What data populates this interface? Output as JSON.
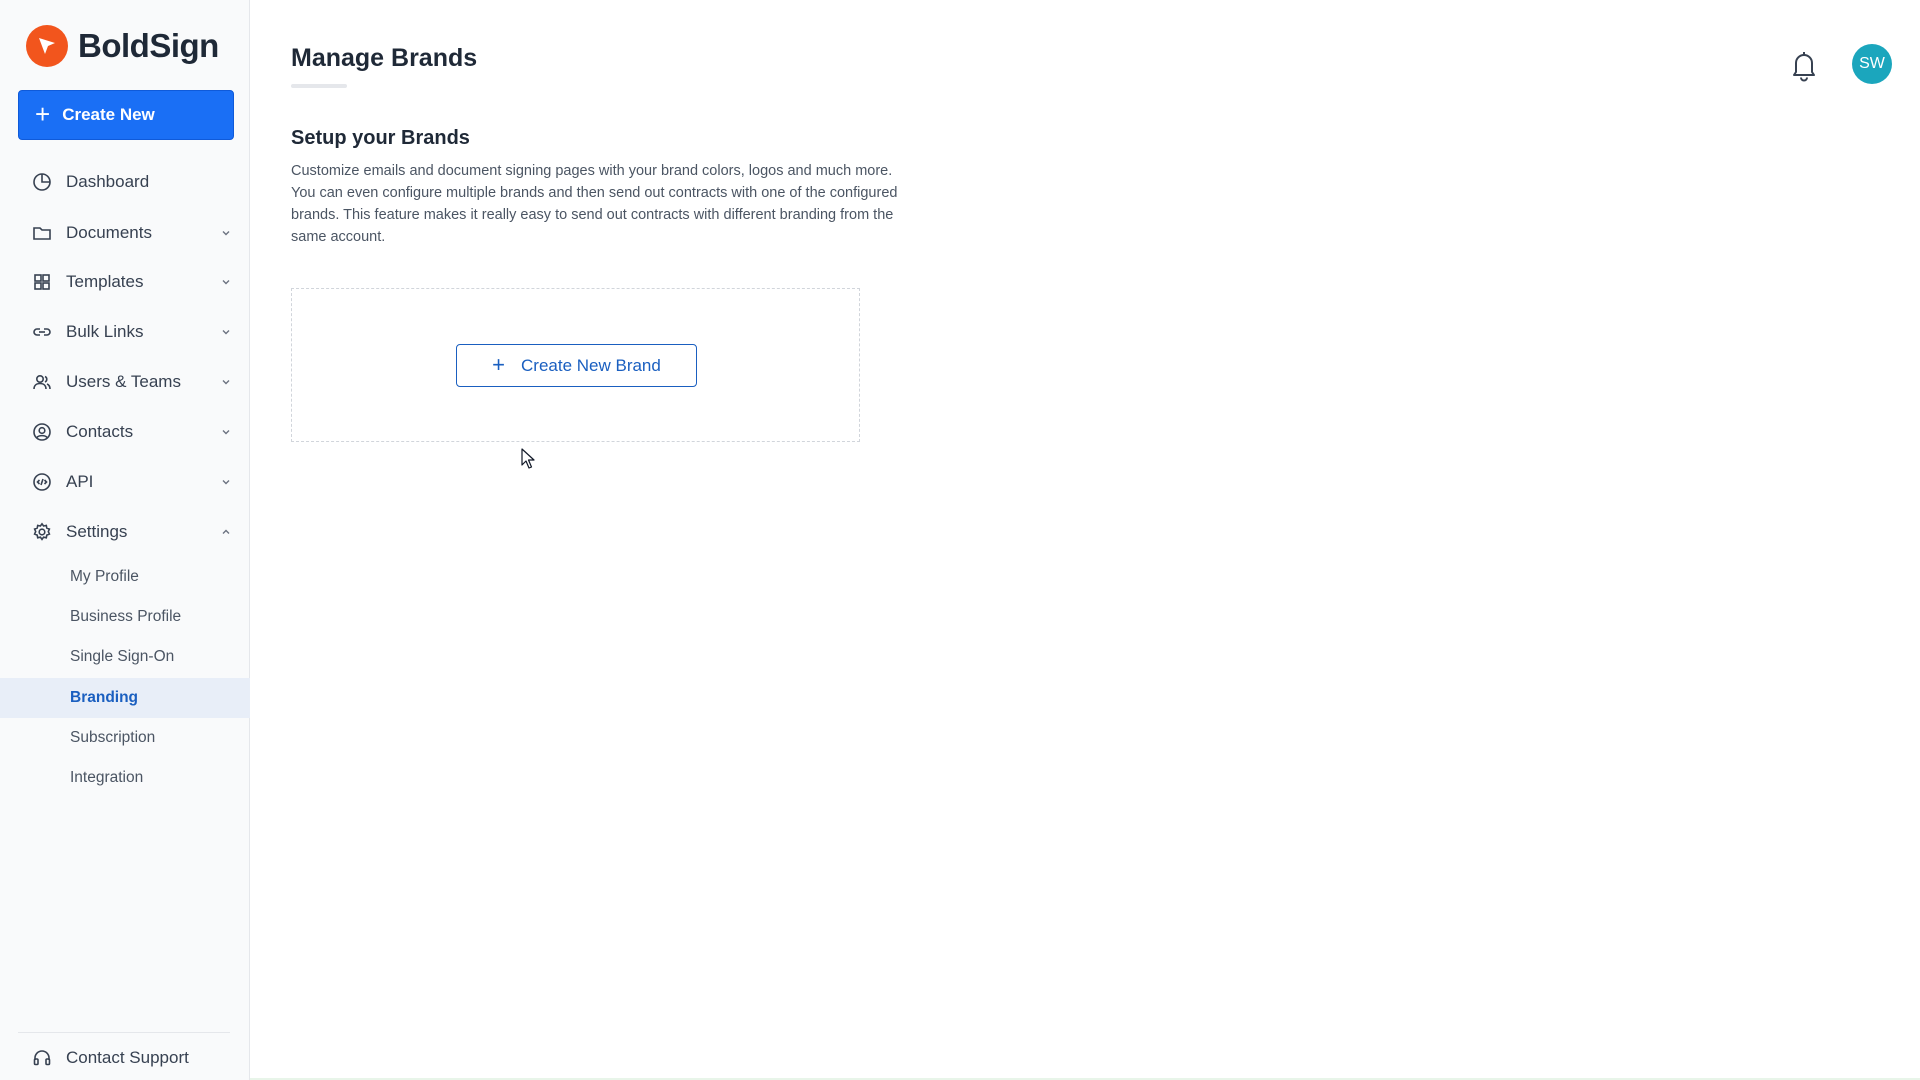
{
  "brand": {
    "name": "BoldSign",
    "accent": "#f2551d"
  },
  "sidebar": {
    "create_label": "Create New",
    "items": [
      {
        "label": "Dashboard",
        "icon": "dashboard-icon"
      },
      {
        "label": "Documents",
        "icon": "folder-icon"
      },
      {
        "label": "Templates",
        "icon": "grid-icon"
      },
      {
        "label": "Bulk Links",
        "icon": "link-icon"
      },
      {
        "label": "Users & Teams",
        "icon": "users-icon"
      },
      {
        "label": "Contacts",
        "icon": "contact-icon"
      },
      {
        "label": "API",
        "icon": "api-icon"
      },
      {
        "label": "Settings",
        "icon": "gear-icon"
      }
    ],
    "settings_items": [
      {
        "label": "My Profile"
      },
      {
        "label": "Business Profile"
      },
      {
        "label": "Single Sign-On"
      },
      {
        "label": "Branding",
        "active": true
      },
      {
        "label": "Subscription"
      },
      {
        "label": "Integration"
      }
    ],
    "support_label": "Contact Support"
  },
  "header": {
    "title": "Manage Brands",
    "avatar_initials": "SW"
  },
  "main": {
    "section_title": "Setup your Brands",
    "description_lines": [
      "Customize emails and document signing pages with your brand colors, logos and much more.",
      "You can even configure multiple brands and then send out contracts with one of the configured",
      "brands. This feature makes it really easy to send out contracts with different branding from the",
      "same account."
    ],
    "create_brand_label": "Create New Brand"
  },
  "colors": {
    "primary": "#1a6ff5",
    "active_bg": "#e8eef8",
    "active_text": "#1a5fc0",
    "avatar_bg": "#1ba6bd"
  }
}
